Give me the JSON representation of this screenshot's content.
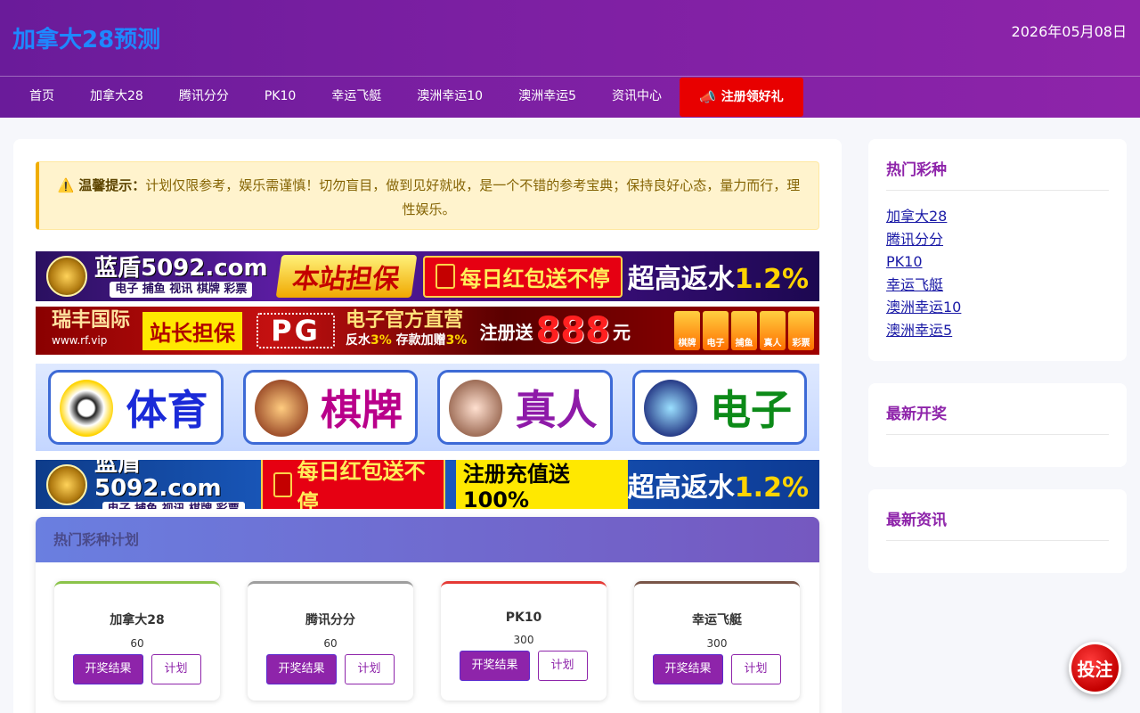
{
  "header": {
    "site_title": "加拿大28预测",
    "date": "2026年05月08日"
  },
  "nav": {
    "items": [
      "首页",
      "加拿大28",
      "腾讯分分",
      "PK10",
      "幸运飞艇",
      "澳洲幸运10",
      "澳洲幸运5",
      "资讯中心"
    ],
    "cta_label": "注册领好礼",
    "cta_icon": "megaphone-icon"
  },
  "notice": {
    "label": "温馨提示：",
    "text": "计划仅限参考，娱乐需谨慎！切勿盲目，做到见好就收，是一个不错的参考宝典；保持良好心态，量力而行，理性娱乐。",
    "icon": "warning-icon"
  },
  "banners": {
    "b1": {
      "brand": "蓝盾5092.com",
      "sub": "电子 捕鱼 视讯 棋牌 彩票",
      "tag": "本站担保",
      "promo": "每日红包送不停",
      "rebate_prefix": "超高返水",
      "rebate_value": "1.2%"
    },
    "b2": {
      "brand": "瑞丰国际",
      "url": "www.rf.vip",
      "tag": "站长担保",
      "pg": "PG",
      "headline": "电子官方直营",
      "sub_a": "反水",
      "sub_a_val": "3%",
      "sub_b": "存款加赠",
      "sub_b_val": "3%",
      "reg_prefix": "注册送",
      "reg_amount": "888",
      "reg_suffix": "元",
      "games": [
        "棋牌",
        "电子",
        "捕鱼",
        "真人",
        "彩票"
      ]
    },
    "b3": {
      "categories": [
        "体育",
        "棋牌",
        "真人",
        "电子"
      ]
    },
    "b4": {
      "brand": "蓝盾5092.com",
      "sub": "电子 捕鱼 视讯 棋牌 彩票",
      "promo": "每日红包送不停",
      "deposit": "注册充值送100%",
      "rebate_prefix": "超高返水",
      "rebate_value": "1.2%"
    }
  },
  "hot_plans": {
    "title": "热门彩种计划",
    "cards": [
      {
        "name": "加拿大28",
        "period": "60",
        "result_label": "开奖结果",
        "plan_label": "计划",
        "accent": "#8bc34a"
      },
      {
        "name": "腾讯分分",
        "period": "60",
        "result_label": "开奖结果",
        "plan_label": "计划",
        "accent": "#9e9e9e"
      },
      {
        "name": "PK10",
        "period": "300",
        "result_label": "开奖结果",
        "plan_label": "计划",
        "accent": "#e53935"
      },
      {
        "name": "幸运飞艇",
        "period": "300",
        "result_label": "开奖结果",
        "plan_label": "计划",
        "accent": "#795548"
      }
    ]
  },
  "sidebar": {
    "hot_title": "热门彩种",
    "hot_links": [
      "加拿大28",
      "腾讯分分",
      "PK10",
      "幸运飞艇",
      "澳洲幸运10",
      "澳洲幸运5"
    ],
    "latest_draw_title": "最新开奖",
    "latest_news_title": "最新资讯"
  },
  "fab": {
    "label": "投注"
  },
  "colors": {
    "header_from": "#6a1b9a",
    "header_to": "#8e24aa",
    "accent_purple": "#8e24aa",
    "title_blue": "#1e88ff",
    "cta_red": "#e80000"
  }
}
